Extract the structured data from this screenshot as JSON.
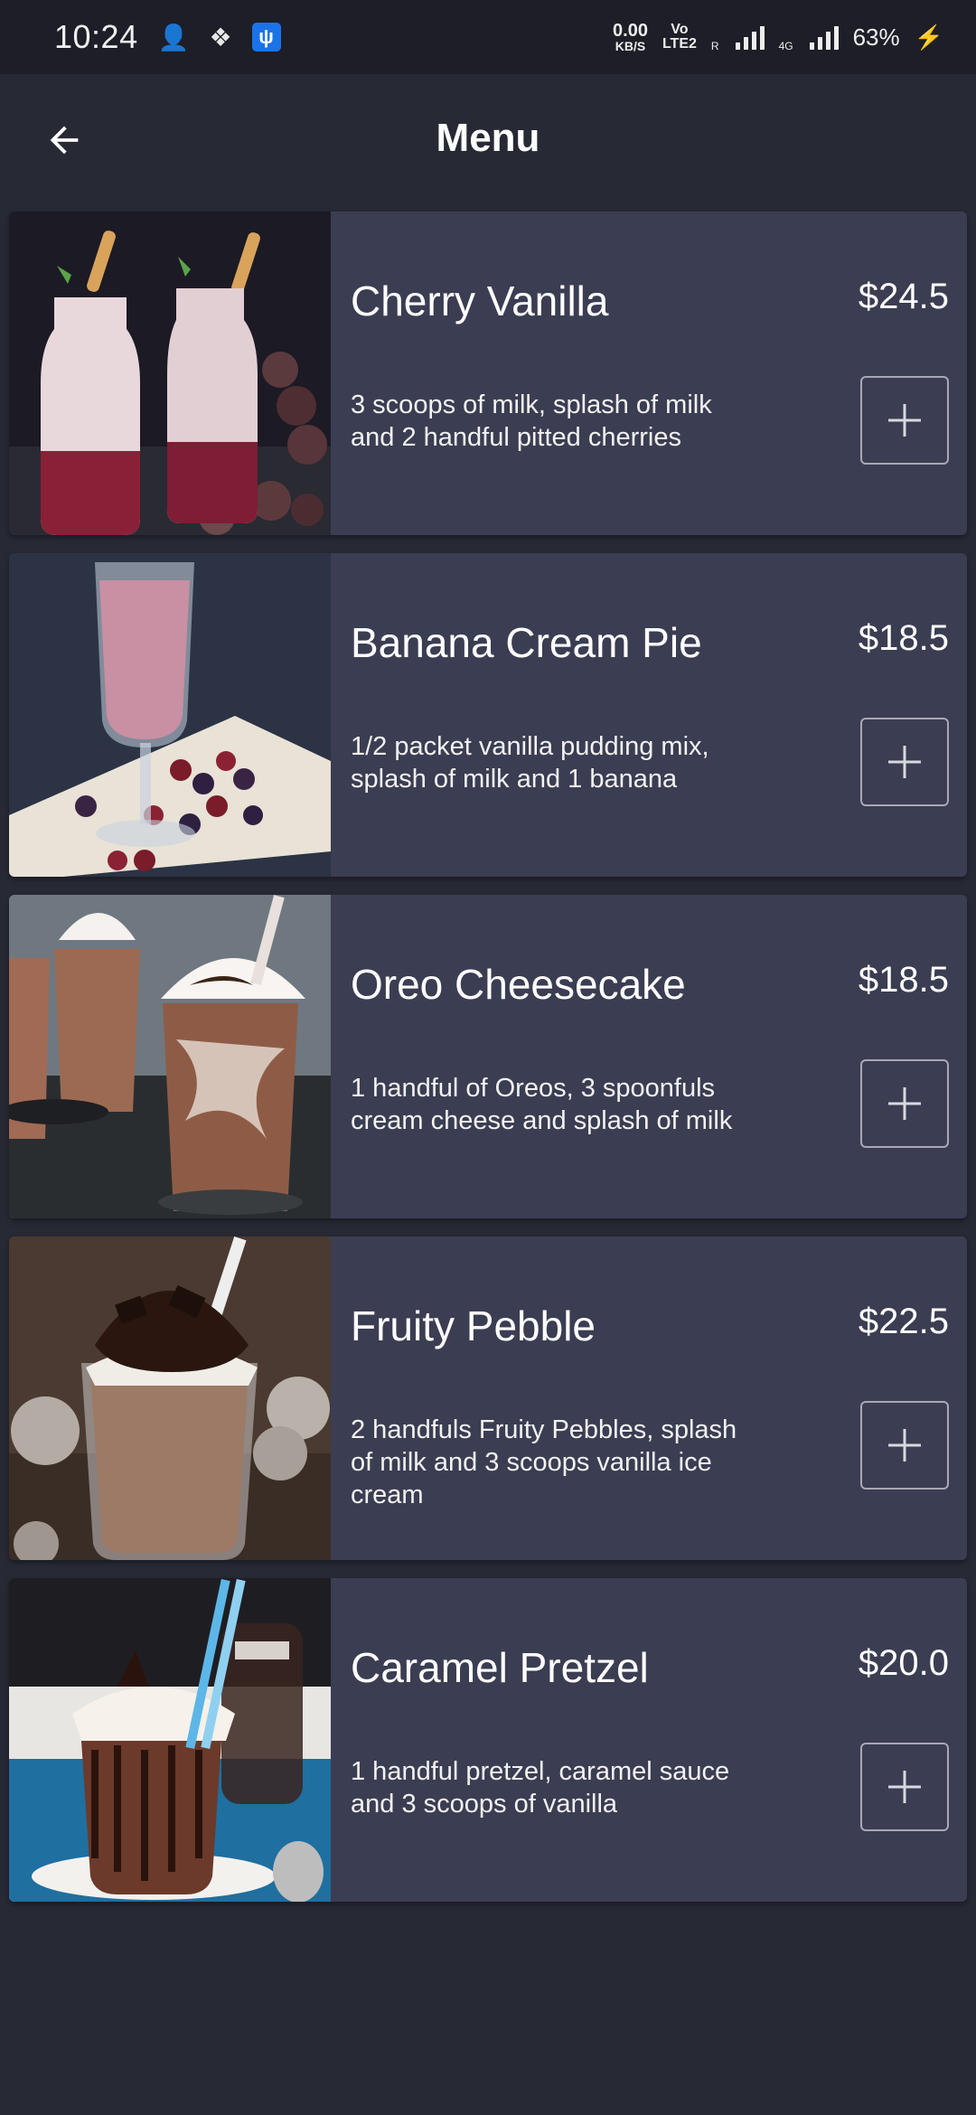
{
  "status_bar": {
    "time": "10:24",
    "net_speed_value": "0.00",
    "net_speed_unit": "KB/S",
    "volte_top": "Vo",
    "volte_bottom": "LTE2",
    "roaming": "R",
    "network_type": "4G",
    "battery": "63%"
  },
  "header": {
    "title": "Menu",
    "back_icon": "arrow-left-icon"
  },
  "menu_items": [
    {
      "name": "Cherry Vanilla",
      "price": "$24.5",
      "description": "3 scoops of milk, splash of milk and 2 handful pitted cherries",
      "image": "cherry-vanilla-shake-photo"
    },
    {
      "name": "Banana Cream Pie",
      "price": "$18.5",
      "description": "1/2 packet vanilla pudding mix, splash of milk and 1 banana",
      "image": "berry-smoothie-glass-photo"
    },
    {
      "name": "Oreo Cheesecake",
      "price": "$18.5",
      "description": "1 handful of Oreos, 3 spoonfuls cream cheese and splash of milk",
      "image": "chocolate-frappe-photo"
    },
    {
      "name": "Fruity Pebble",
      "price": "$22.5",
      "description": "2 handfuls Fruity Pebbles, splash of milk and 3 scoops vanilla ice cream",
      "image": "cookies-cream-shake-photo"
    },
    {
      "name": "Caramel Pretzel",
      "price": "$20.0",
      "description": "1 handful pretzel, caramel sauce and 3 scoops of vanilla",
      "image": "chocolate-milkshake-photo"
    }
  ],
  "colors": {
    "background": "#272935",
    "card": "#3b3d52",
    "status_bar": "#1d1e27",
    "add_button_border": "#a7a9b7"
  }
}
